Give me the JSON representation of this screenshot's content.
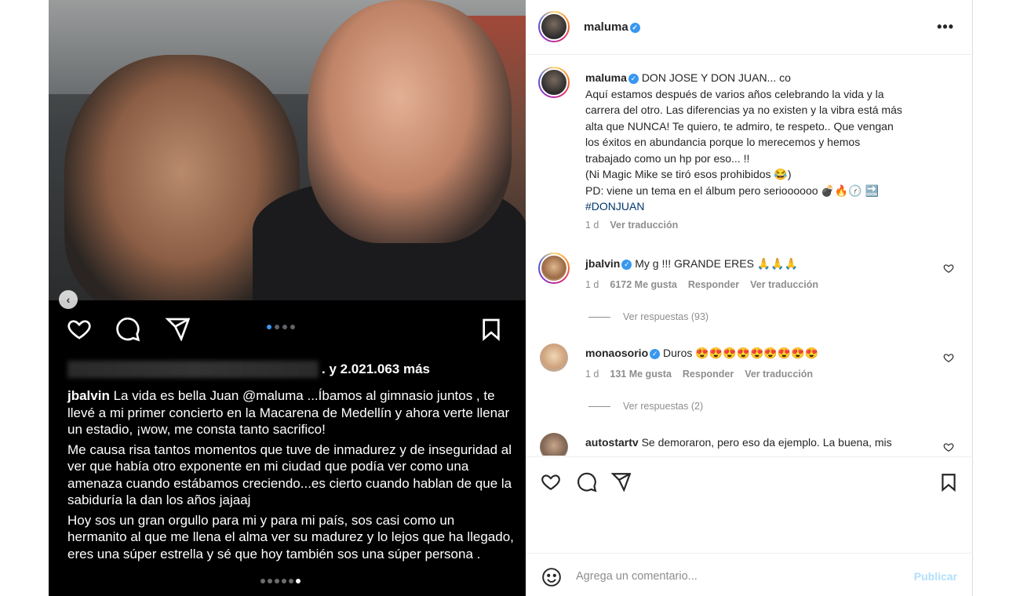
{
  "media": {
    "likes_suffix": ". y 2.021.063 más",
    "caption": {
      "username": "jbalvin",
      "para1": "La vida es bella Juan @maluma ...Íbamos al gimnasio juntos , te llevé a mi primer concierto en la Macarena de Medellín y ahora verte llenar un estadio, ¡wow, me consta tanto sacrifico!",
      "para2": "Me causa risa tantos momentos que tuve de inmadurez y de inseguridad al ver que había otro exponente en mi ciudad que podía ver como una amenaza cuando estábamos creciendo...es cierto cuando hablan de que la sabiduría la dan los años jajaaj",
      "para3": "Hoy sos un gran orgullo para mi y para mi país, sos casi como un hermanito al que me llena el alma ver su madurez y lo lejos que ha llegado,  eres una súper estrella y sé que hoy también sos una súper persona ."
    },
    "prev_icon": "chevron-left-icon"
  },
  "header": {
    "username": "maluma",
    "more_label": "•••"
  },
  "post": {
    "username": "maluma",
    "title": "DON JOSE Y DON JUAN... co",
    "body_lines": [
      "Aquí estamos después de varios años celebrando la vida y la",
      "carrera del otro. Las diferencias ya no existen y la vibra está más",
      "alta que NUNCA! Te quiero, te admiro, te respeto.. Que vengan",
      "los éxitos en abundancia porque lo merecemos y hemos",
      "trabajado como un hp por eso... !!",
      "(Ni Magic Mike se tiró esos prohibidos 😂)",
      "PD: viene un tema en el álbum pero serioooooo 💣🔥🕜 🔜"
    ],
    "hashtag": "#DONJUAN",
    "time": "1 d",
    "translate": "Ver traducción"
  },
  "comments": [
    {
      "username": "jbalvin",
      "text": "My g !!! GRANDE ERES 🙏🙏🙏",
      "time": "1 d",
      "likes": "6172 Me gusta",
      "reply": "Responder",
      "translate": "Ver traducción",
      "view_replies": "Ver respuestas (93)"
    },
    {
      "username": "monaosorio",
      "text": "Duros 😍😍😍😍😍😍😍😍😍",
      "time": "1 d",
      "likes": "131 Me gusta",
      "reply": "Responder",
      "translate": "Ver traducción",
      "view_replies": "Ver respuestas (2)"
    },
    {
      "username": "autostartv",
      "text": "Se demoraron, pero eso da ejemplo. La buena, mis"
    }
  ],
  "add_comment": {
    "placeholder": "Agrega un comentario...",
    "publish": "Publicar"
  },
  "colors": {
    "accent": "#3897f0",
    "publish_disabled": "#b2dffc",
    "muted": "#8e8e8e",
    "text": "#262626"
  }
}
